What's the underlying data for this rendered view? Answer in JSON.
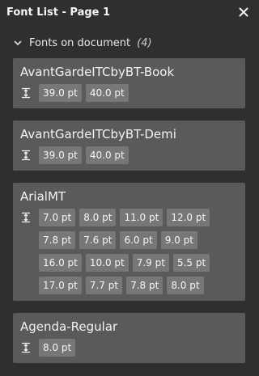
{
  "panel": {
    "title": "Font List - Page 1"
  },
  "section": {
    "label": "Fonts on document",
    "count": "(4)"
  },
  "fonts": [
    {
      "name": "AvantGardeITCbyBT-Book",
      "sizes": [
        "39.0 pt",
        "40.0 pt"
      ]
    },
    {
      "name": "AvantGardeITCbyBT-Demi",
      "sizes": [
        "39.0 pt",
        "40.0 pt"
      ]
    },
    {
      "name": "ArialMT",
      "sizes": [
        "7.0 pt",
        "8.0 pt",
        "11.0 pt",
        "12.0 pt",
        "7.8 pt",
        "7.6 pt",
        "6.0 pt",
        "9.0 pt",
        "16.0 pt",
        "10.0 pt",
        "7.9 pt",
        "5.5 pt",
        "17.0 pt",
        "7.7 pt",
        "7.8 pt",
        "8.0 pt"
      ]
    },
    {
      "name": "Agenda-Regular",
      "sizes": [
        "8.0 pt"
      ]
    }
  ]
}
